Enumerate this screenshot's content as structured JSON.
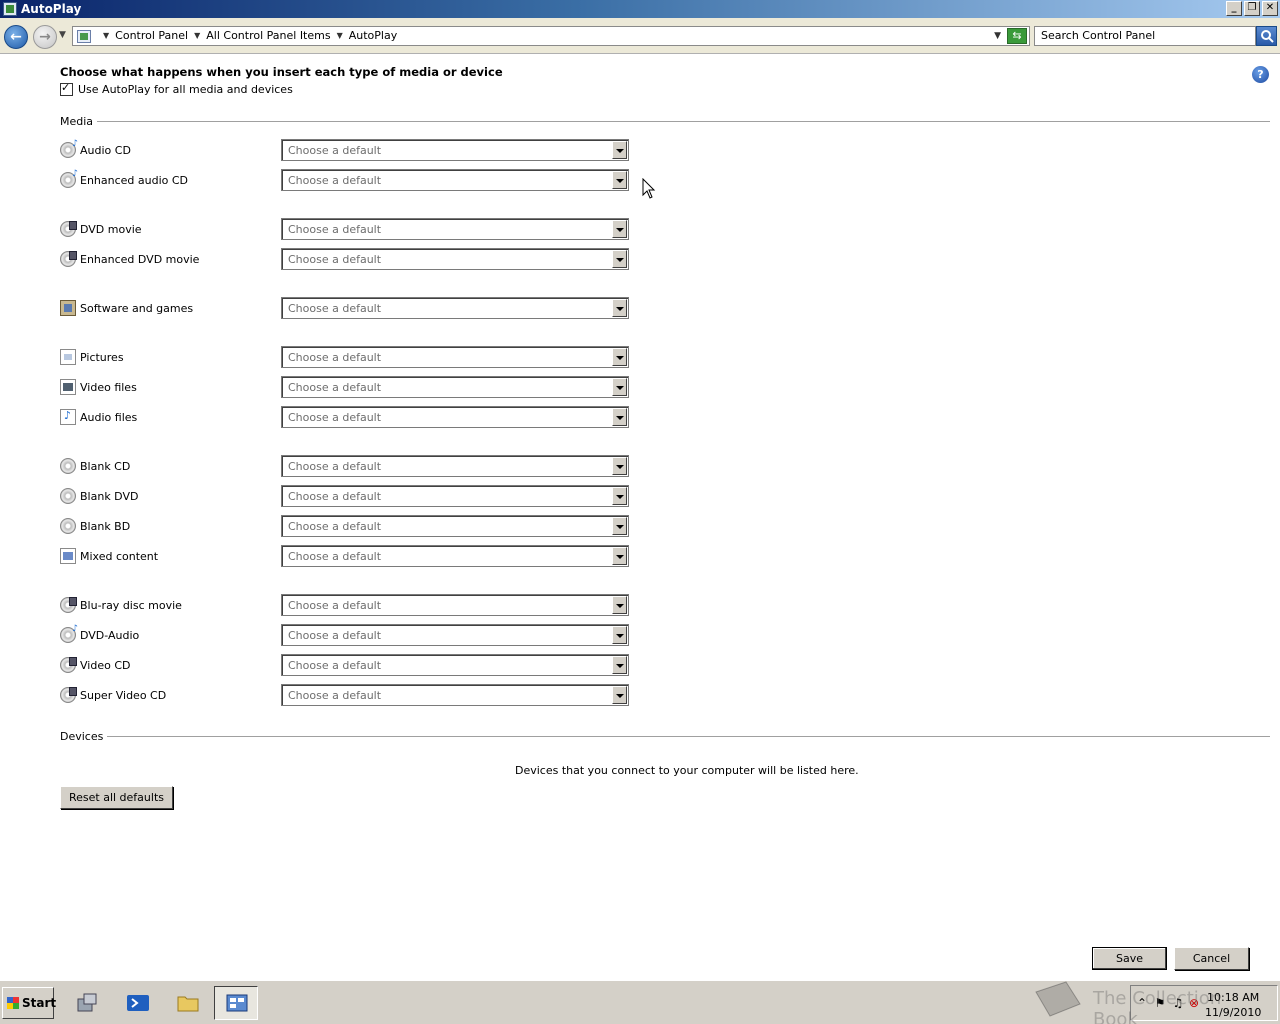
{
  "window": {
    "title": "AutoPlay"
  },
  "address": {
    "crumbs": [
      "Control Panel",
      "All Control Panel Items",
      "AutoPlay"
    ],
    "search_placeholder": "Search Control Panel"
  },
  "main": {
    "heading": "Choose what happens when you insert each type of media or device",
    "use_autoplay_label": "Use AutoPlay for all media and devices",
    "use_autoplay_checked": true,
    "media_group_label": "Media",
    "media_items": [
      {
        "label": "Audio CD",
        "icon": "audio-disc-icon",
        "value": "Choose a default"
      },
      {
        "label": "Enhanced audio CD",
        "icon": "audio-disc-icon",
        "value": "Choose a default"
      },
      {
        "label": "DVD movie",
        "icon": "dvd-movie-icon",
        "value": "Choose a default"
      },
      {
        "label": "Enhanced DVD movie",
        "icon": "dvd-movie-icon",
        "value": "Choose a default"
      },
      {
        "label": "Software and games",
        "icon": "software-icon",
        "value": "Choose a default"
      },
      {
        "label": "Pictures",
        "icon": "picture-file-icon",
        "value": "Choose a default"
      },
      {
        "label": "Video files",
        "icon": "video-file-icon",
        "value": "Choose a default"
      },
      {
        "label": "Audio files",
        "icon": "audio-file-icon",
        "value": "Choose a default"
      },
      {
        "label": "Blank CD",
        "icon": "blank-disc-icon",
        "value": "Choose a default"
      },
      {
        "label": "Blank DVD",
        "icon": "blank-disc-icon",
        "value": "Choose a default"
      },
      {
        "label": "Blank BD",
        "icon": "blank-disc-icon",
        "value": "Choose a default"
      },
      {
        "label": "Mixed content",
        "icon": "mixed-content-icon",
        "value": "Choose a default"
      },
      {
        "label": "Blu-ray disc movie",
        "icon": "dvd-movie-icon",
        "value": "Choose a default"
      },
      {
        "label": "DVD-Audio",
        "icon": "audio-disc-icon",
        "value": "Choose a default"
      },
      {
        "label": "Video CD",
        "icon": "dvd-movie-icon",
        "value": "Choose a default"
      },
      {
        "label": "Super Video CD",
        "icon": "dvd-movie-icon",
        "value": "Choose a default"
      }
    ],
    "devices_group_label": "Devices",
    "devices_note": "Devices that you connect to your computer will be listed here.",
    "reset_label": "Reset all defaults",
    "save_label": "Save",
    "cancel_label": "Cancel"
  },
  "taskbar": {
    "start_label": "Start",
    "clock_time": "10:18 AM",
    "clock_date": "11/9/2010",
    "watermark": "The Collection Book"
  }
}
